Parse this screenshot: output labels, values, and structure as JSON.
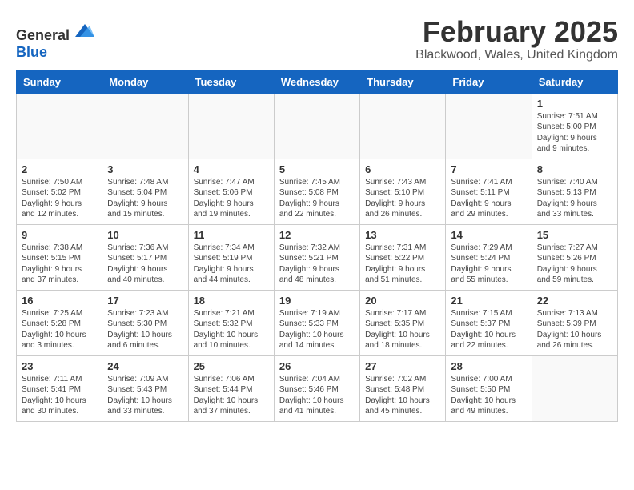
{
  "header": {
    "logo_general": "General",
    "logo_blue": "Blue",
    "month": "February 2025",
    "location": "Blackwood, Wales, United Kingdom"
  },
  "days_of_week": [
    "Sunday",
    "Monday",
    "Tuesday",
    "Wednesday",
    "Thursday",
    "Friday",
    "Saturday"
  ],
  "weeks": [
    [
      {
        "date": "",
        "info": ""
      },
      {
        "date": "",
        "info": ""
      },
      {
        "date": "",
        "info": ""
      },
      {
        "date": "",
        "info": ""
      },
      {
        "date": "",
        "info": ""
      },
      {
        "date": "",
        "info": ""
      },
      {
        "date": "1",
        "info": "Sunrise: 7:51 AM\nSunset: 5:00 PM\nDaylight: 9 hours and 9 minutes."
      }
    ],
    [
      {
        "date": "2",
        "info": "Sunrise: 7:50 AM\nSunset: 5:02 PM\nDaylight: 9 hours and 12 minutes."
      },
      {
        "date": "3",
        "info": "Sunrise: 7:48 AM\nSunset: 5:04 PM\nDaylight: 9 hours and 15 minutes."
      },
      {
        "date": "4",
        "info": "Sunrise: 7:47 AM\nSunset: 5:06 PM\nDaylight: 9 hours and 19 minutes."
      },
      {
        "date": "5",
        "info": "Sunrise: 7:45 AM\nSunset: 5:08 PM\nDaylight: 9 hours and 22 minutes."
      },
      {
        "date": "6",
        "info": "Sunrise: 7:43 AM\nSunset: 5:10 PM\nDaylight: 9 hours and 26 minutes."
      },
      {
        "date": "7",
        "info": "Sunrise: 7:41 AM\nSunset: 5:11 PM\nDaylight: 9 hours and 29 minutes."
      },
      {
        "date": "8",
        "info": "Sunrise: 7:40 AM\nSunset: 5:13 PM\nDaylight: 9 hours and 33 minutes."
      }
    ],
    [
      {
        "date": "9",
        "info": "Sunrise: 7:38 AM\nSunset: 5:15 PM\nDaylight: 9 hours and 37 minutes."
      },
      {
        "date": "10",
        "info": "Sunrise: 7:36 AM\nSunset: 5:17 PM\nDaylight: 9 hours and 40 minutes."
      },
      {
        "date": "11",
        "info": "Sunrise: 7:34 AM\nSunset: 5:19 PM\nDaylight: 9 hours and 44 minutes."
      },
      {
        "date": "12",
        "info": "Sunrise: 7:32 AM\nSunset: 5:21 PM\nDaylight: 9 hours and 48 minutes."
      },
      {
        "date": "13",
        "info": "Sunrise: 7:31 AM\nSunset: 5:22 PM\nDaylight: 9 hours and 51 minutes."
      },
      {
        "date": "14",
        "info": "Sunrise: 7:29 AM\nSunset: 5:24 PM\nDaylight: 9 hours and 55 minutes."
      },
      {
        "date": "15",
        "info": "Sunrise: 7:27 AM\nSunset: 5:26 PM\nDaylight: 9 hours and 59 minutes."
      }
    ],
    [
      {
        "date": "16",
        "info": "Sunrise: 7:25 AM\nSunset: 5:28 PM\nDaylight: 10 hours and 3 minutes."
      },
      {
        "date": "17",
        "info": "Sunrise: 7:23 AM\nSunset: 5:30 PM\nDaylight: 10 hours and 6 minutes."
      },
      {
        "date": "18",
        "info": "Sunrise: 7:21 AM\nSunset: 5:32 PM\nDaylight: 10 hours and 10 minutes."
      },
      {
        "date": "19",
        "info": "Sunrise: 7:19 AM\nSunset: 5:33 PM\nDaylight: 10 hours and 14 minutes."
      },
      {
        "date": "20",
        "info": "Sunrise: 7:17 AM\nSunset: 5:35 PM\nDaylight: 10 hours and 18 minutes."
      },
      {
        "date": "21",
        "info": "Sunrise: 7:15 AM\nSunset: 5:37 PM\nDaylight: 10 hours and 22 minutes."
      },
      {
        "date": "22",
        "info": "Sunrise: 7:13 AM\nSunset: 5:39 PM\nDaylight: 10 hours and 26 minutes."
      }
    ],
    [
      {
        "date": "23",
        "info": "Sunrise: 7:11 AM\nSunset: 5:41 PM\nDaylight: 10 hours and 30 minutes."
      },
      {
        "date": "24",
        "info": "Sunrise: 7:09 AM\nSunset: 5:43 PM\nDaylight: 10 hours and 33 minutes."
      },
      {
        "date": "25",
        "info": "Sunrise: 7:06 AM\nSunset: 5:44 PM\nDaylight: 10 hours and 37 minutes."
      },
      {
        "date": "26",
        "info": "Sunrise: 7:04 AM\nSunset: 5:46 PM\nDaylight: 10 hours and 41 minutes."
      },
      {
        "date": "27",
        "info": "Sunrise: 7:02 AM\nSunset: 5:48 PM\nDaylight: 10 hours and 45 minutes."
      },
      {
        "date": "28",
        "info": "Sunrise: 7:00 AM\nSunset: 5:50 PM\nDaylight: 10 hours and 49 minutes."
      },
      {
        "date": "",
        "info": ""
      }
    ]
  ]
}
